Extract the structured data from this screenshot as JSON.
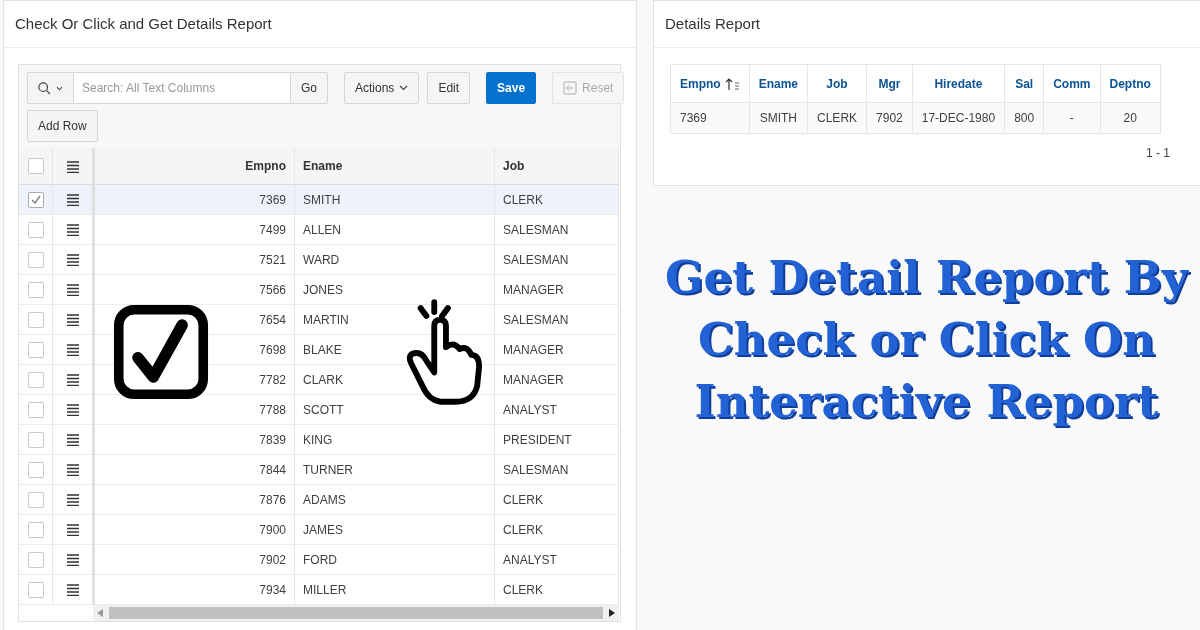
{
  "left_panel": {
    "title": "Check Or Click and Get Details Report",
    "toolbar": {
      "search": {
        "placeholder": "Search: All Text Columns",
        "button": "Go"
      },
      "buttons": [
        {
          "label": "Actions",
          "kind": "menu"
        },
        {
          "label": "Edit",
          "kind": "plain"
        },
        {
          "label": "Save",
          "kind": "primary"
        },
        {
          "label": "Reset",
          "kind": "reset",
          "disabled": true
        }
      ],
      "second_row": [
        {
          "label": "Add Row",
          "kind": "plain"
        }
      ]
    },
    "grid": {
      "columns": [
        "Empno",
        "Ename",
        "Job"
      ],
      "header_checked": false,
      "rows": [
        {
          "empno": "7369",
          "ename": "SMITH",
          "job": "CLERK",
          "selected": true
        },
        {
          "empno": "7499",
          "ename": "ALLEN",
          "job": "SALESMAN",
          "selected": false
        },
        {
          "empno": "7521",
          "ename": "WARD",
          "job": "SALESMAN",
          "selected": false
        },
        {
          "empno": "7566",
          "ename": "JONES",
          "job": "MANAGER",
          "selected": false
        },
        {
          "empno": "7654",
          "ename": "MARTIN",
          "job": "SALESMAN",
          "selected": false
        },
        {
          "empno": "7698",
          "ename": "BLAKE",
          "job": "MANAGER",
          "selected": false
        },
        {
          "empno": "7782",
          "ename": "CLARK",
          "job": "MANAGER",
          "selected": false
        },
        {
          "empno": "7788",
          "ename": "SCOTT",
          "job": "ANALYST",
          "selected": false
        },
        {
          "empno": "7839",
          "ename": "KING",
          "job": "PRESIDENT",
          "selected": false
        },
        {
          "empno": "7844",
          "ename": "TURNER",
          "job": "SALESMAN",
          "selected": false
        },
        {
          "empno": "7876",
          "ename": "ADAMS",
          "job": "CLERK",
          "selected": false
        },
        {
          "empno": "7900",
          "ename": "JAMES",
          "job": "CLERK",
          "selected": false
        },
        {
          "empno": "7902",
          "ename": "FORD",
          "job": "ANALYST",
          "selected": false
        },
        {
          "empno": "7934",
          "ename": "MILLER",
          "job": "CLERK",
          "selected": false
        }
      ]
    }
  },
  "right_panel": {
    "title": "Details Report",
    "columns": [
      {
        "label": "Empno",
        "sorted": true
      },
      {
        "label": "Ename",
        "sorted": false
      },
      {
        "label": "Job",
        "sorted": false
      },
      {
        "label": "Mgr",
        "sorted": false
      },
      {
        "label": "Hiredate",
        "sorted": false
      },
      {
        "label": "Sal",
        "sorted": false
      },
      {
        "label": "Comm",
        "sorted": false
      },
      {
        "label": "Deptno",
        "sorted": false
      }
    ],
    "rows": [
      [
        "7369",
        "SMITH",
        "CLERK",
        "7902",
        "17-DEC-1980",
        "800",
        "-",
        "20"
      ]
    ],
    "pagination": "1 - 1"
  },
  "headline": [
    "Get Detail Report By",
    "Check or Click On",
    "Interactive Report"
  ]
}
